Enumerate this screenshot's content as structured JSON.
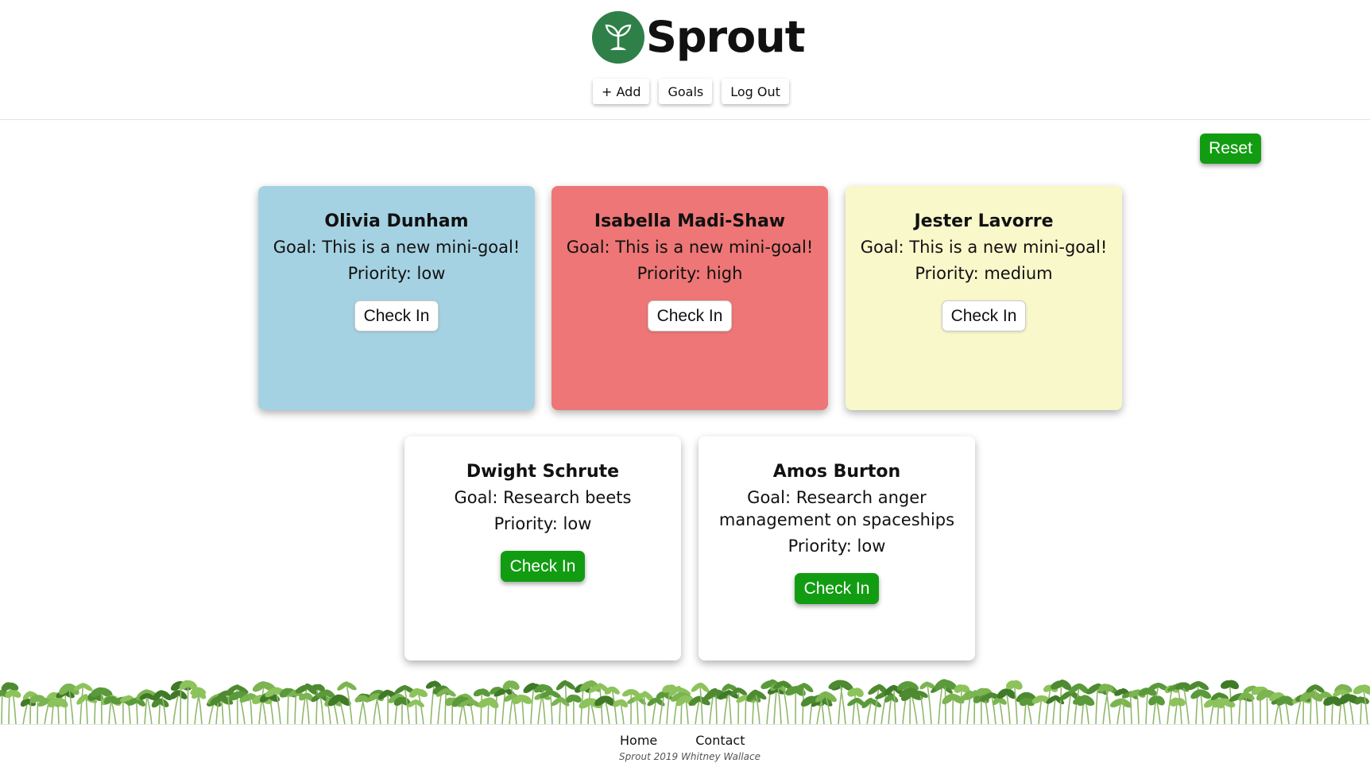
{
  "header": {
    "logo_text": "Sprout",
    "logo_icon": "sprout-icon",
    "nav": {
      "add_label": "+ Add",
      "goals_label": "Goals",
      "logout_label": "Log Out"
    }
  },
  "reset_label": "Reset",
  "colors": {
    "accent_green": "#129c12",
    "logo_green": "#2e8048",
    "card_low": "#a5d2e2",
    "card_high": "#ee7676",
    "card_medium": "#f9f8cb",
    "card_plain": "#ffffff"
  },
  "cards": [
    {
      "name": "Olivia Dunham",
      "goal": "Goal: This is a new mini-goal!",
      "priority": "Priority: low",
      "button": "Check In"
    },
    {
      "name": "Isabella Madi-Shaw",
      "goal": "Goal: This is a new mini-goal!",
      "priority": "Priority: high",
      "button": "Check In"
    },
    {
      "name": "Jester Lavorre",
      "goal": "Goal: This is a new mini-goal!",
      "priority": "Priority: medium",
      "button": "Check In"
    },
    {
      "name": "Dwight Schrute",
      "goal": "Goal: Research beets",
      "priority": "Priority: low",
      "button": "Check In"
    },
    {
      "name": "Amos Burton",
      "goal": "Goal: Research anger management on spaceships",
      "priority": "Priority: low",
      "button": "Check In"
    }
  ],
  "footer": {
    "home_label": "Home",
    "contact_label": "Contact",
    "credit": "Sprout 2019 Whitney Wallace"
  }
}
